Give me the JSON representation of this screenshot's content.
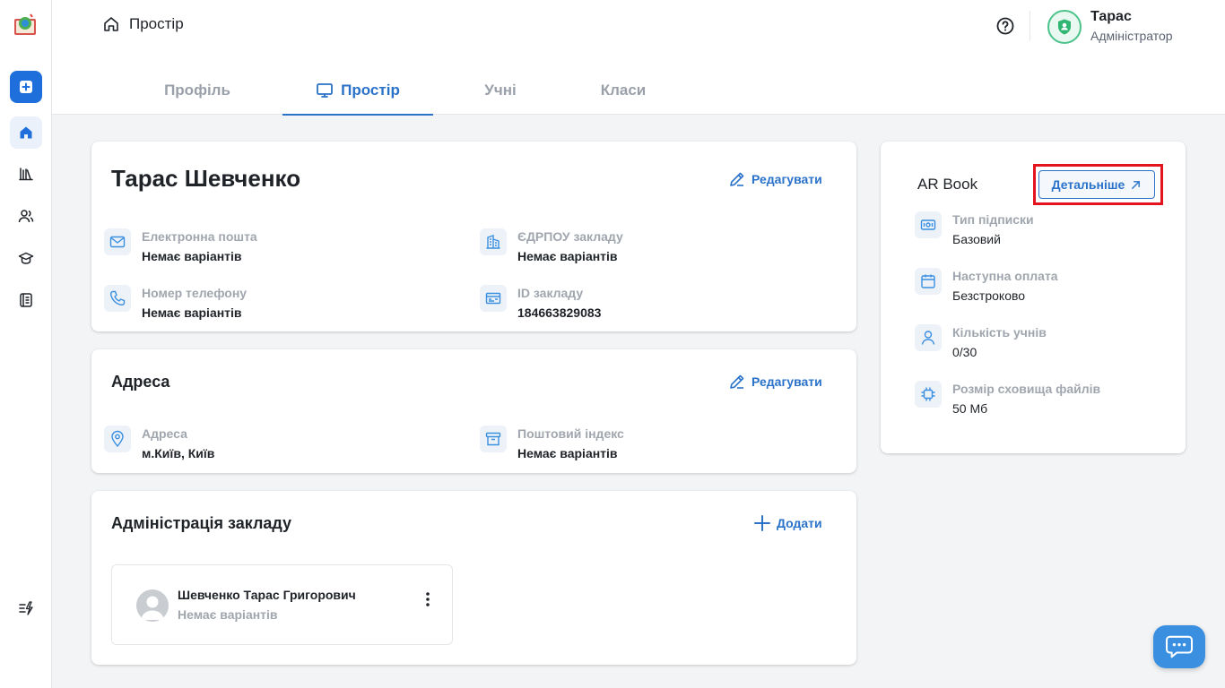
{
  "header": {
    "breadcrumb": "Простір",
    "user_name": "Тарас",
    "user_role": "Адміністратор"
  },
  "tabs": [
    {
      "label": "Профіль",
      "active": false
    },
    {
      "label": "Простір",
      "active": true
    },
    {
      "label": "Учні",
      "active": false
    },
    {
      "label": "Класи",
      "active": false
    }
  ],
  "profile": {
    "name": "Тарас Шевченко",
    "edit_label": "Редагувати",
    "fields": [
      {
        "label": "Електронна пошта",
        "value": "Немає варіантів",
        "icon": "mail-icon"
      },
      {
        "label": "ЄДРПОУ закладу",
        "value": "Немає варіантів",
        "icon": "building-icon"
      },
      {
        "label": "Номер телефону",
        "value": "Немає варіантів",
        "icon": "phone-icon"
      },
      {
        "label": "ID закладу",
        "value": "184663829083",
        "icon": "id-card-icon"
      }
    ]
  },
  "address": {
    "title": "Адреса",
    "edit_label": "Редагувати",
    "fields": [
      {
        "label": "Адреса",
        "value": "м.Київ, Київ",
        "icon": "location-pin-icon"
      },
      {
        "label": "Поштовий індекс",
        "value": "Немає варіантів",
        "icon": "archive-box-icon"
      }
    ]
  },
  "administration": {
    "title": "Адміністрація закладу",
    "add_label": "Додати",
    "members": [
      {
        "name": "Шевченко Тарас Григорович",
        "sub": "Немає варіантів"
      }
    ]
  },
  "subscription": {
    "title": "AR Book",
    "details_label": "Детальніше",
    "items": [
      {
        "label": "Тип підписки",
        "value": "Базовий",
        "icon": "ticket-icon"
      },
      {
        "label": "Наступна оплата",
        "value": "Безстроково",
        "icon": "calendar-icon"
      },
      {
        "label": "Кількість учнів",
        "value": "0/30",
        "icon": "user-icon"
      },
      {
        "label": "Розмір сховища файлів",
        "value": "50 Мб",
        "icon": "chip-icon"
      }
    ]
  },
  "colors": {
    "accent": "#2a72c9",
    "highlight": "#e4141f",
    "chat": "#3a8fe0"
  }
}
